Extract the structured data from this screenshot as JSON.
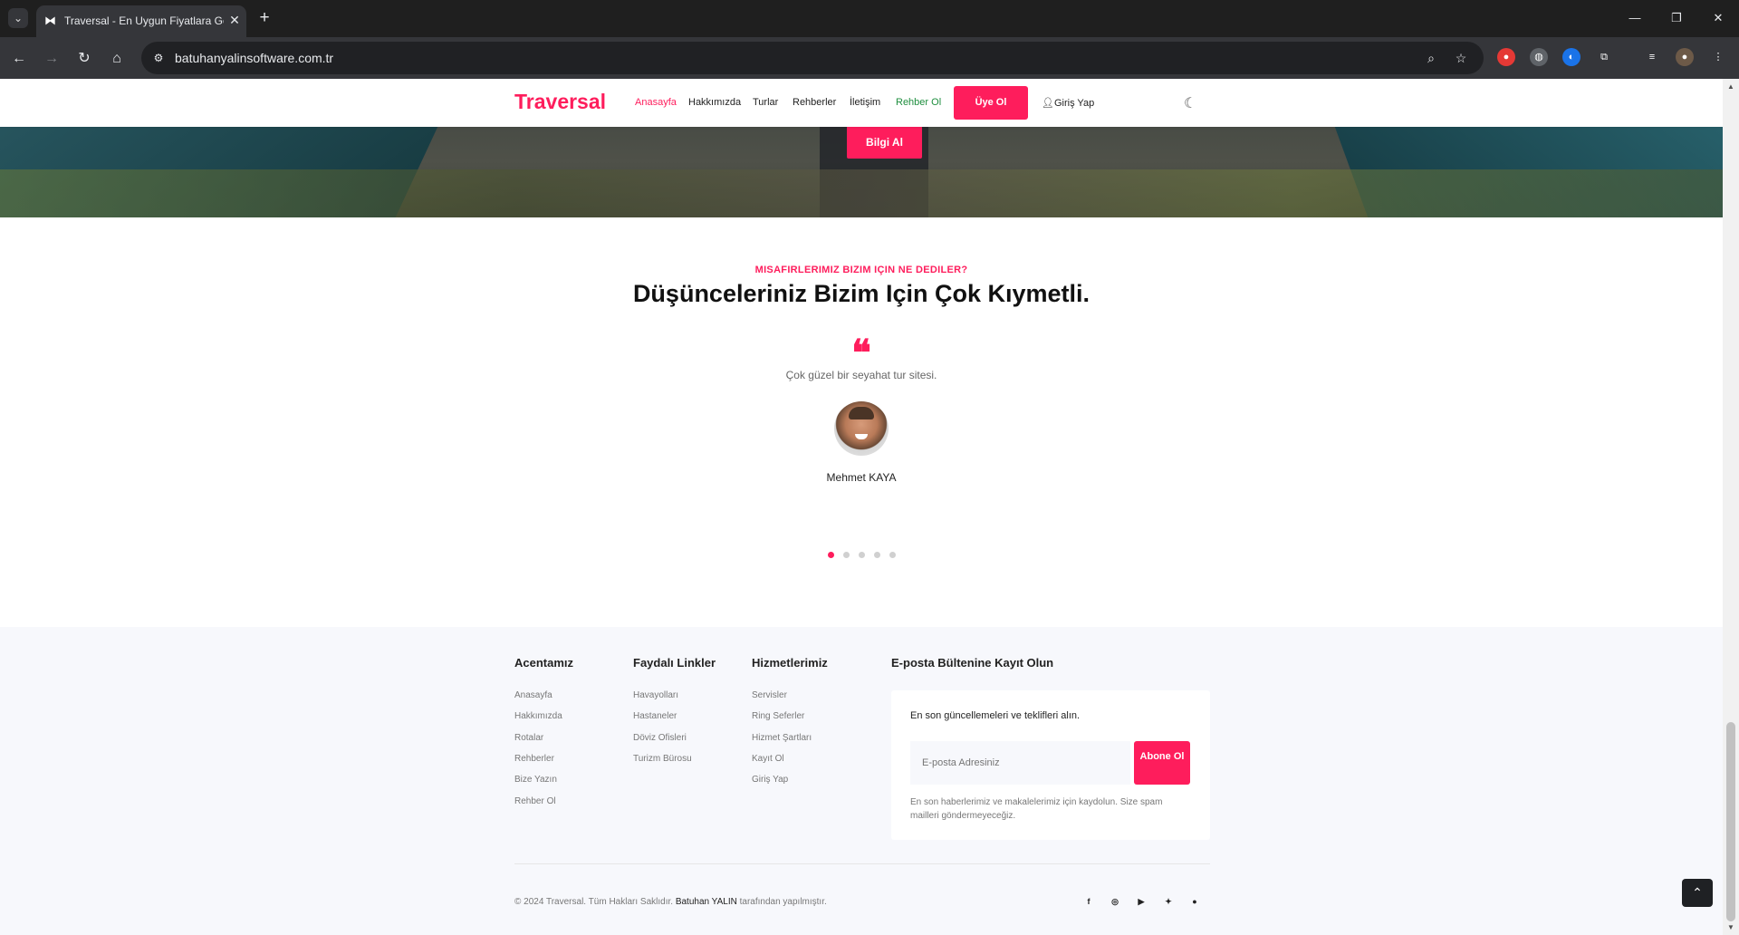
{
  "browser": {
    "tab_title": "Traversal - En Uygun Fiyatlara Ge",
    "url": "batuhanyalinsoftware.com.tr"
  },
  "nav": {
    "brand": "Traversal",
    "items": [
      "Anasayfa",
      "Hakkımızda",
      "Turlar",
      "Rehberler",
      "İletişim",
      "Rehber Ol"
    ],
    "signup": "Üye Ol",
    "login": "Giriş Yap"
  },
  "hero": {
    "button": "Bilgi Al"
  },
  "testimonials": {
    "subtitle": "MISAFIRLERIMIZ BIZIM IÇIN NE DEDILER?",
    "title": "Düşünceleriniz Bizim Için Çok Kıymetli.",
    "quote_mark": "❝",
    "text": "Çok güzel bir seyahat tur sitesi.",
    "name": "Mehmet KAYA",
    "dots": 5,
    "active_dot": 0
  },
  "footer": {
    "col1": {
      "title": "Acentamız",
      "links": [
        "Anasayfa",
        "Hakkımızda",
        "Rotalar",
        "Rehberler",
        "Bize Yazın",
        "Rehber Ol"
      ]
    },
    "col2": {
      "title": "Faydalı Linkler",
      "links": [
        "Havayolları",
        "Hastaneler",
        "Döviz Ofisleri",
        "Turizm Bürosu"
      ]
    },
    "col3": {
      "title": "Hizmetlerimiz",
      "links": [
        "Servisler",
        "Ring Seferler",
        "Hizmet Şartları",
        "Kayıt Ol",
        "Giriş Yap"
      ]
    },
    "newsletter": {
      "title": "E-posta Bültenine Kayıt Olun",
      "intro": "En son güncellemeleri ve teklifleri alın.",
      "placeholder": "E-posta Adresiniz",
      "button": "Abone Ol",
      "note": "En son haberlerimiz ve makalelerimiz için kaydolun. Size spam mailleri göndermeyeceğiz."
    },
    "copyright": "© 2024 Traversal. Tüm Hakları Saklıdır.",
    "author": "Batuhan YALIN",
    "suffix": "tarafından yapılmıştır.",
    "social": [
      "facebook-icon",
      "instagram-icon",
      "youtube-icon",
      "twitter-icon",
      "github-icon"
    ]
  },
  "colors": {
    "accent": "#fe1d5c",
    "green": "#1e8e3e"
  }
}
